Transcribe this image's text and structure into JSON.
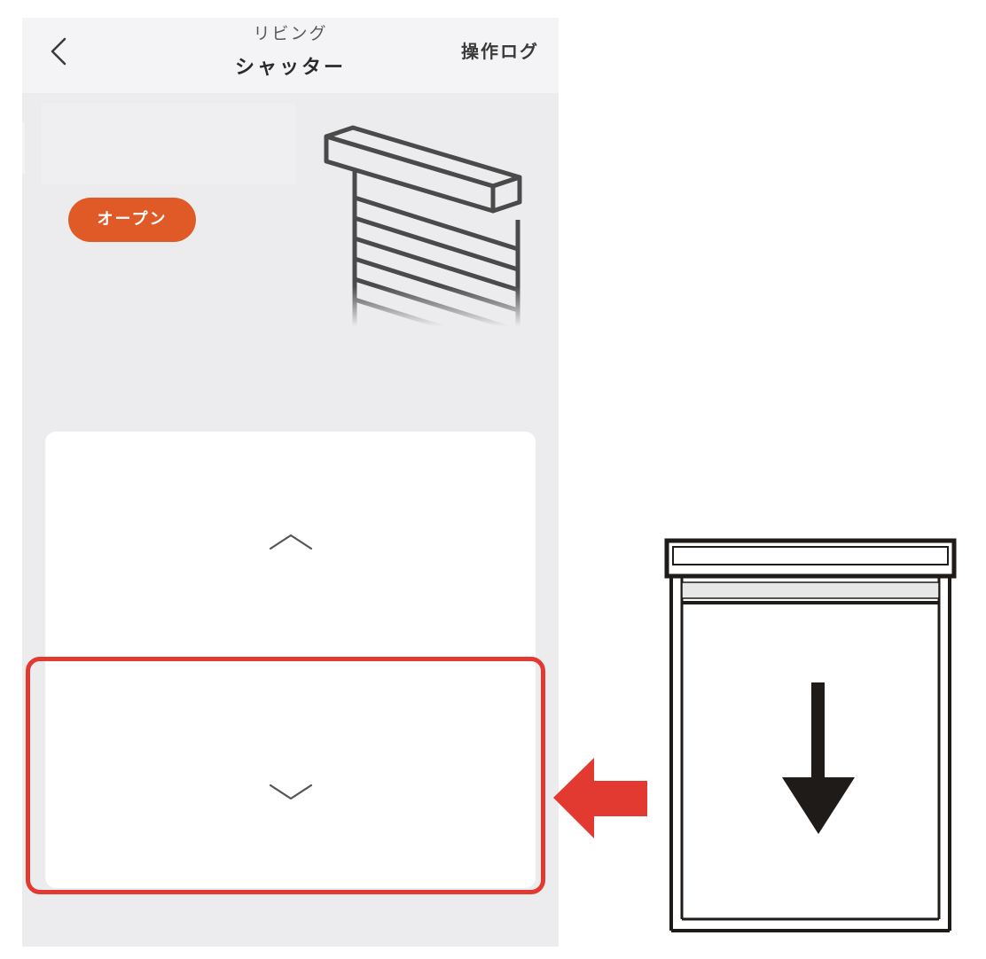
{
  "header": {
    "room_label": "リビング",
    "device_title": "シャッター",
    "log_link_label": "操作ログ"
  },
  "status": {
    "badge_label": "オープン",
    "badge_color": "#df5a26"
  },
  "controls": {
    "up_icon": "chevron-up-icon",
    "down_icon": "chevron-down-icon",
    "highlighted": "down-button"
  },
  "annotation": {
    "highlight_color": "#e23a30",
    "pointer_icon": "arrow-left-icon",
    "physical_button_icon": "down-arrow-icon"
  }
}
